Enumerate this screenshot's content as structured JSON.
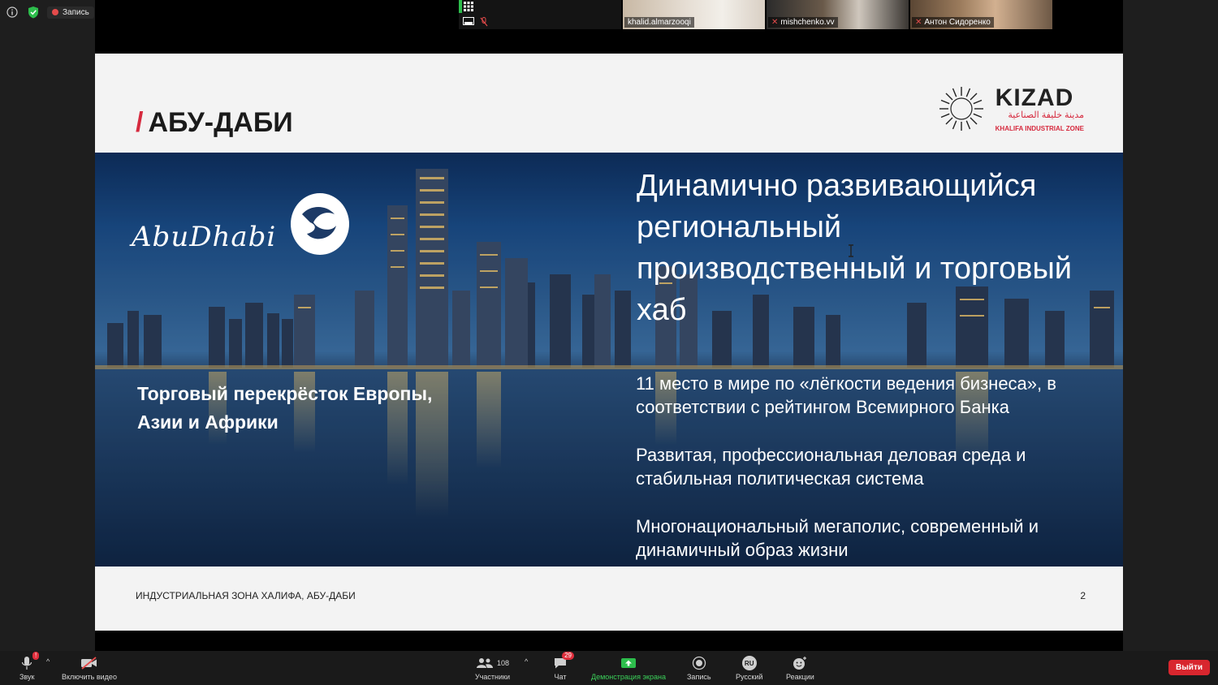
{
  "status": {
    "record_label": "Запись"
  },
  "participants_strip": [
    {
      "name": "khalid.almarzooqi"
    },
    {
      "name": "mishchenko.vv"
    },
    {
      "name": "Антон Сидоренко"
    }
  ],
  "slide": {
    "title_slash": "/",
    "title": "АБУ-ДАБИ",
    "logo_name": "KIZAD",
    "logo_arabic": "مدينة خليفة الصناعية",
    "logo_sub": "KHALIFA INDUSTRIAL ZONE",
    "city_logo_text": "AbuDhabi",
    "tagline": "Торговый перекрёсток Европы, Азии и Африки",
    "headline": "Динамично развивающийся региональный производственный и торговый хаб",
    "bullets": [
      "11 место в мире по «лёгкости ведения бизнеса», в соответствии с рейтингом Всемирного Банка",
      "Развитая, профессиональная деловая среда и стабильная политическая система",
      "Многонациональный мегаполис, современный и динамичный образ жизни"
    ],
    "footer_text": "ИНДУСТРИАЛЬНАЯ ЗОНА ХАЛИФА, АБУ-ДАБИ",
    "page_number": "2"
  },
  "toolbar": {
    "audio_label": "Звук",
    "audio_badge": "!",
    "video_label": "Включить видео",
    "participants_label": "Участники",
    "participants_count": "108",
    "chat_label": "Чат",
    "chat_badge": "29",
    "share_label": "Демонстрация экрана",
    "record_label": "Запись",
    "language_code": "RU",
    "language_label": "Русский",
    "reactions_label": "Реакции",
    "leave_label": "Выйти"
  },
  "colors": {
    "accent_red": "#d62a3e",
    "share_green": "#3bd15a",
    "leave_red": "#d8262e"
  }
}
